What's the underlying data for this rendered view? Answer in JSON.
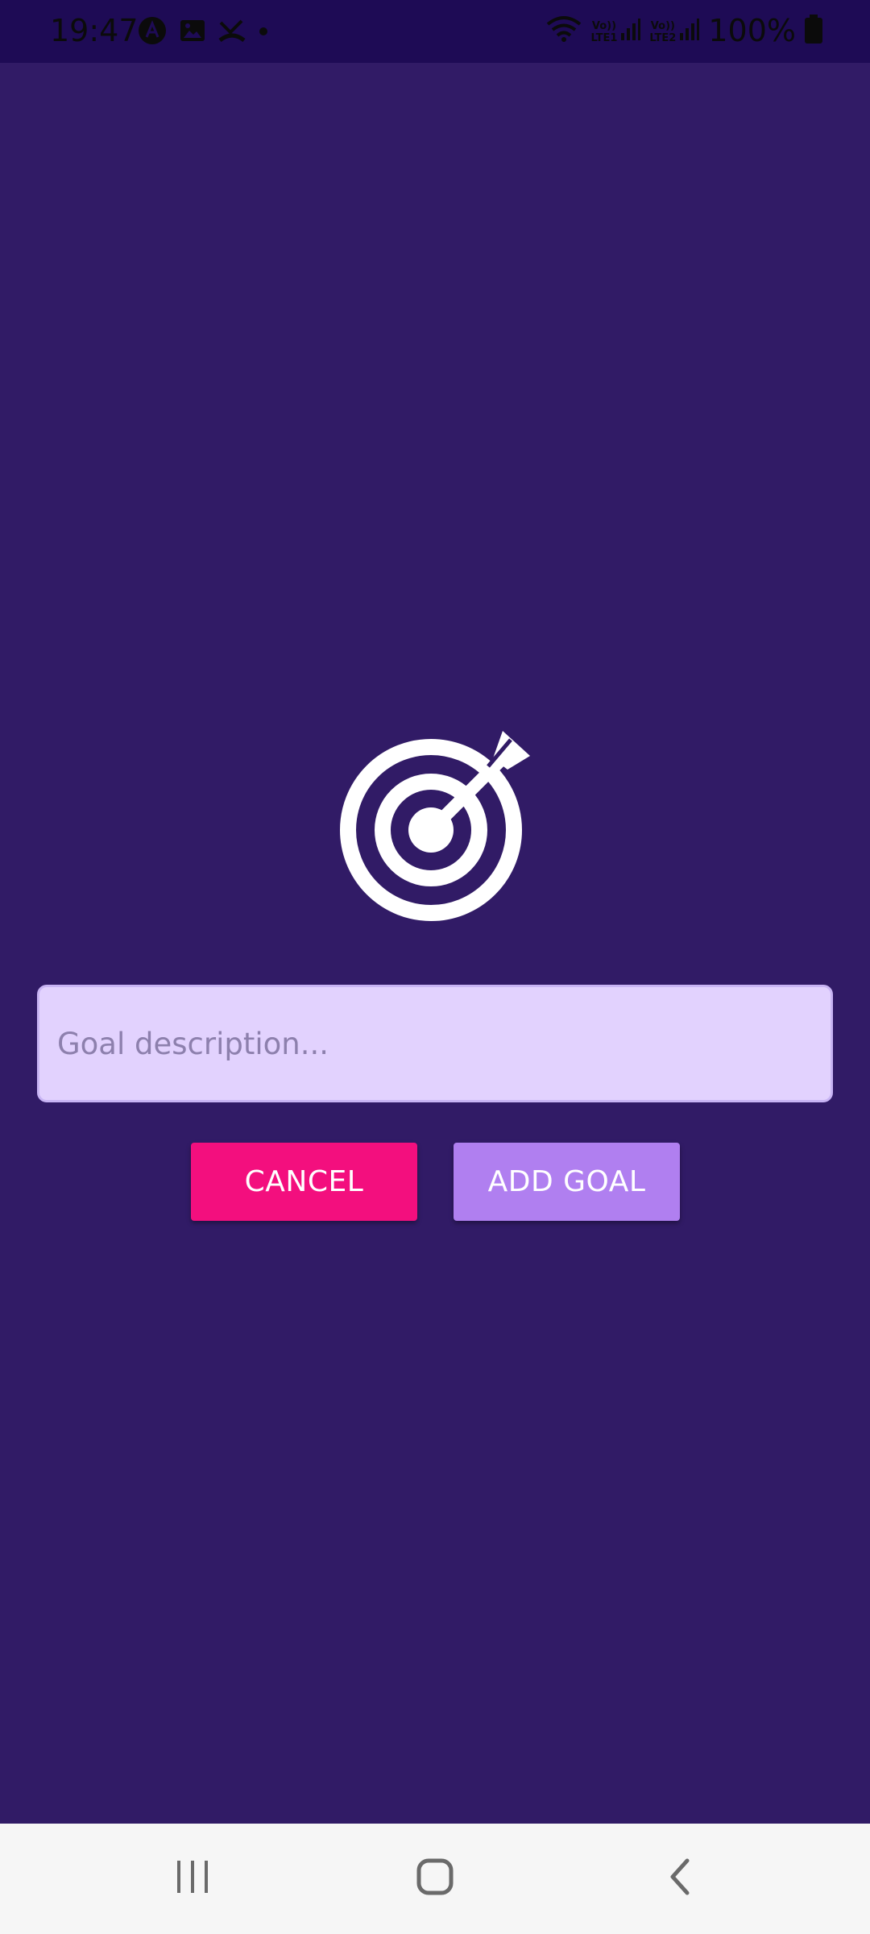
{
  "status_bar": {
    "time": "19:47",
    "battery_text": "100%",
    "sim1_label": "LTE1",
    "sim2_label": "LTE2",
    "volte_label": "Vo))",
    "left_icons": [
      "app-notification-icon",
      "gallery-icon",
      "missed-call-icon",
      "dot-icon"
    ],
    "right_icons": [
      "wifi-icon",
      "signal-icon",
      "battery-icon"
    ]
  },
  "main": {
    "icon": "target-arrow-icon",
    "input": {
      "placeholder": "Goal description...",
      "value": ""
    },
    "cancel_label": "CANCEL",
    "add_label": "ADD GOAL"
  },
  "nav_bar": {
    "icons": [
      "recent-apps-icon",
      "home-icon",
      "back-icon"
    ]
  },
  "colors": {
    "background": "#311b66",
    "status_bar": "#1e0b55",
    "input_background": "#e2d2fe",
    "cancel": "#f30f7e",
    "add": "#b07ff0",
    "nav_bar": "#f6f6f6"
  }
}
